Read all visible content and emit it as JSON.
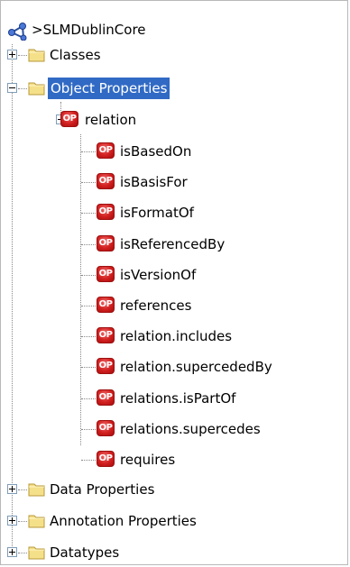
{
  "root": {
    "label": ">SLMDublinCore",
    "icon": "ontology-icon"
  },
  "tree": {
    "classes": {
      "label": "Classes",
      "state": "collapsed"
    },
    "object_properties": {
      "label": "Object Properties",
      "state": "expanded",
      "selected": true,
      "relation": {
        "label": "relation",
        "state": "expanded",
        "children": [
          "isBasedOn",
          "isBasisFor",
          "isFormatOf",
          "isReferencedBy",
          "isVersionOf",
          "references",
          "relation.includes",
          "relation.supercededBy",
          "relations.isPartOf",
          "relations.supercedes",
          "requires"
        ]
      }
    },
    "data_properties": {
      "label": "Data Properties",
      "state": "collapsed"
    },
    "annotation_properties": {
      "label": "Annotation Properties",
      "state": "collapsed"
    },
    "datatypes": {
      "label": "Datatypes",
      "state": "collapsed"
    }
  },
  "icons": {
    "op_badge": "OP",
    "folder": "folder-icon",
    "property": "object-property-icon"
  },
  "colors": {
    "selection": "#316ac5",
    "op_red": "#d11f1f",
    "folder_yellow": "#f5e08a"
  }
}
